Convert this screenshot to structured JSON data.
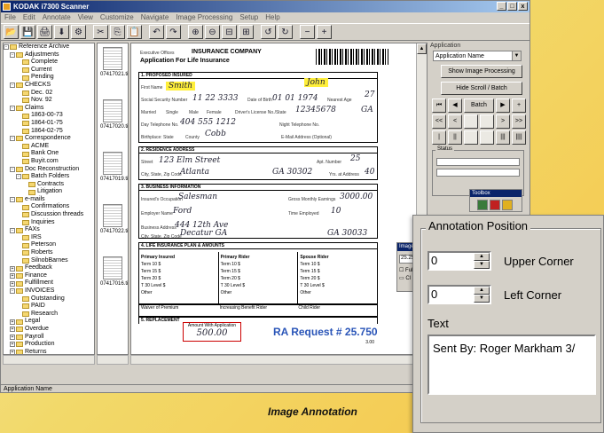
{
  "window": {
    "title": "KODAK i7300 Scanner",
    "controls": [
      "_",
      "□",
      "x"
    ]
  },
  "menu": [
    "File",
    "Edit",
    "Annotate",
    "View",
    "Customize",
    "Navigate",
    "Image Processing",
    "Setup",
    "Help"
  ],
  "toolbar": {
    "buttons": [
      "open-folder",
      "save",
      "print",
      "scan",
      "scan-settings",
      "cut",
      "copy",
      "paste",
      "undo",
      "redo",
      "zoom-in",
      "zoom-out",
      "fit-width",
      "fit-page",
      "rotate",
      "rotate-right",
      "minus",
      "plus"
    ],
    "glyphs": [
      "📂",
      "💾",
      "🖨",
      "⬇",
      "⚙",
      "✂",
      "⎘",
      "📋",
      "↶",
      "↷",
      "⊕",
      "⊖",
      "⊟",
      "⊞",
      "↺",
      "↻",
      "−",
      "+"
    ]
  },
  "tree": [
    {
      "level": 0,
      "pm": "-",
      "label": "Reference Archive"
    },
    {
      "level": 1,
      "pm": "-",
      "label": "Adjustments"
    },
    {
      "level": 2,
      "pm": "",
      "label": "Complete"
    },
    {
      "level": 2,
      "pm": "",
      "label": "Current"
    },
    {
      "level": 2,
      "pm": "",
      "label": "Pending"
    },
    {
      "level": 1,
      "pm": "-",
      "label": "CHECKS"
    },
    {
      "level": 2,
      "pm": "",
      "label": "Dec. 02"
    },
    {
      "level": 2,
      "pm": "",
      "label": "Nov. 92"
    },
    {
      "level": 1,
      "pm": "-",
      "label": "Claims"
    },
    {
      "level": 2,
      "pm": "",
      "label": "1863-00-73"
    },
    {
      "level": 2,
      "pm": "",
      "label": "1864-01-75"
    },
    {
      "level": 2,
      "pm": "",
      "label": "1864-02-75"
    },
    {
      "level": 1,
      "pm": "-",
      "label": "Correspondence"
    },
    {
      "level": 2,
      "pm": "",
      "label": "ACME"
    },
    {
      "level": 2,
      "pm": "",
      "label": "Bank One"
    },
    {
      "level": 2,
      "pm": "",
      "label": "Buyit.com"
    },
    {
      "level": 1,
      "pm": "-",
      "label": "Doc Reconstruction"
    },
    {
      "level": 2,
      "pm": "-",
      "label": "Batch Folders"
    },
    {
      "level": 3,
      "pm": "",
      "label": "Contracts"
    },
    {
      "level": 3,
      "pm": "",
      "label": "Litigation"
    },
    {
      "level": 1,
      "pm": "-",
      "label": "e-mails"
    },
    {
      "level": 2,
      "pm": "",
      "label": "Confirmations"
    },
    {
      "level": 2,
      "pm": "",
      "label": "Discussion threads"
    },
    {
      "level": 2,
      "pm": "",
      "label": "Inquiries"
    },
    {
      "level": 1,
      "pm": "-",
      "label": "FAXs"
    },
    {
      "level": 2,
      "pm": "",
      "label": "IRS"
    },
    {
      "level": 2,
      "pm": "",
      "label": "Peterson"
    },
    {
      "level": 2,
      "pm": "",
      "label": "Roberts"
    },
    {
      "level": 2,
      "pm": "",
      "label": "SilnobBarnes"
    },
    {
      "level": 1,
      "pm": "+",
      "label": "Feedback"
    },
    {
      "level": 1,
      "pm": "+",
      "label": "Finance"
    },
    {
      "level": 1,
      "pm": "+",
      "label": "Fulfillment"
    },
    {
      "level": 1,
      "pm": "-",
      "label": "INVOICES"
    },
    {
      "level": 2,
      "pm": "",
      "label": "Outstanding"
    },
    {
      "level": 2,
      "pm": "",
      "label": "PAID"
    },
    {
      "level": 2,
      "pm": "",
      "label": "Research"
    },
    {
      "level": 1,
      "pm": "+",
      "label": "Legal"
    },
    {
      "level": 1,
      "pm": "+",
      "label": "Overdue"
    },
    {
      "level": 1,
      "pm": "+",
      "label": "Payroll"
    },
    {
      "level": 1,
      "pm": "+",
      "label": "Production"
    },
    {
      "level": 1,
      "pm": "+",
      "label": "Returns"
    }
  ],
  "thumbnails": [
    "07417021.tif",
    "07417020.tif",
    "07417019.tif",
    "07417022.tif",
    "07417016.tif"
  ],
  "document": {
    "company": "INSURANCE COMPANY",
    "office": "Executive Offices",
    "title": "Application For Life Insurance",
    "sections": {
      "insured": "1. PROPOSED INSURED",
      "residence": "2. RESIDENCE ADDRESS",
      "business": "3. BUSINESS INFORMATION",
      "plan": "4. LIFE INSURANCE PLAN & AMOUNTS",
      "replacement": "5. REPLACEMENT"
    },
    "labels": {
      "first_name": "First Name",
      "last_name": "Last Name",
      "ssn": "Social Security Number",
      "dob": "Date of Birth",
      "nearest_age": "Nearest Age",
      "married": "Married",
      "single": "Single",
      "male": "Male",
      "female": "Female",
      "license": "Driver's License No./State",
      "phone": "Day Telephone No.",
      "night_phone": "Night Telephone No.",
      "birth_state": "Birthplace: State",
      "county": "County",
      "email": "E-Mail Address (Optional)",
      "street": "Street",
      "apt": "Apt. Number",
      "city": "City, State, Zip Code",
      "yrs_address": "Yrs. at Address",
      "occupation": "Insured's Occupation",
      "earnings": "Gross Monthly Earnings",
      "employer": "Employer Name",
      "time_employed": "Time Employed",
      "bus_address": "Business Address",
      "bus_city": "City, State, Zip Code",
      "primary_insured": "Primary Insured",
      "primary_rider": "Primary Rider",
      "spouse_rider": "Spouse Rider",
      "waiver": "Waiver of Premium",
      "benefit_rider": "Increasing Benefit Rider",
      "child_rider": "Child Rider",
      "amount_caption": "Amount With Application"
    },
    "values": {
      "first_name": "John",
      "last_name": "Smith",
      "ssn": "11 22 3333",
      "dob": "01 01 1974",
      "nearest_age": "27",
      "license": "12345678",
      "license_state": "GA",
      "phone": "404 555 1212",
      "county": "Cobb",
      "street": "123 Elm Street",
      "apt": "25",
      "city": "Atlanta",
      "state_zip": "GA 30302",
      "yrs_address": "40",
      "occupation": "Salesman",
      "earnings": "3000.00",
      "employer": "Ford",
      "time_employed": "10",
      "bus_address": "444 12th Ave",
      "bus_city": "Decatur GA",
      "bus_zip": "GA 30033",
      "amount": "500.00"
    },
    "plan_rows": {
      "primary": [
        "Term 10 $",
        "Term 15 $",
        "Term 20 $",
        "T 30 Level $",
        "Other"
      ],
      "rider": [
        "Term 10 $",
        "Term 15 $",
        "Term 20 $",
        "T 30 Level $",
        "Other"
      ],
      "spouse": [
        "Term 10 $",
        "Term 15 $",
        "Term 20 $",
        "T 30 Level $",
        "Other"
      ]
    },
    "annotation": "RA Request # 25.750",
    "page_no": "3.00"
  },
  "right_panel": {
    "application_label": "Application",
    "application_value": "Application Name",
    "show_image_processing": "Show Image Processing",
    "hide_scroll": "Hide Scroll / Batch",
    "nav_buttons": [
      "⏮",
      "◀",
      "Batch",
      "▶",
      "⏭",
      "+",
      "<<",
      "<",
      ">",
      ">>",
      "|",
      "||",
      "|||",
      "||||"
    ],
    "status_label": "Status",
    "toolbox_label": "Toolbox",
    "image_label": "Image O",
    "image_value": "25.25",
    "image_opts": [
      "Full",
      "Cl"
    ]
  },
  "status_bar": {
    "text": "Application Name"
  },
  "annotation_panel": {
    "title": "Annotation Position",
    "upper_value": "0",
    "upper_label": "Upper Corner",
    "left_value": "0",
    "left_label": "Left Corner",
    "text_label": "Text",
    "text_value": "Sent By: Roger Markham 3/"
  },
  "caption": "Image Annotation"
}
